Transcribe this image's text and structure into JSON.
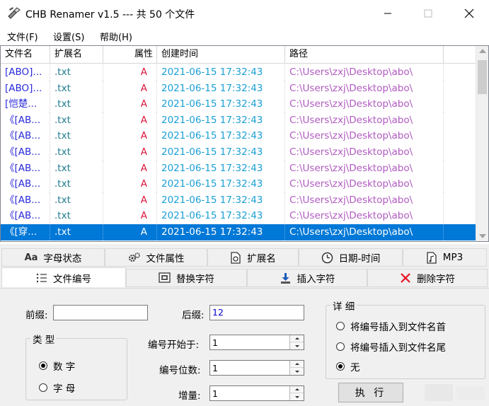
{
  "window": {
    "title": "CHB Renamer v1.5 --- 共 50 个文件"
  },
  "menu": [
    "文件(F)",
    "设置(S)",
    "帮助(H)"
  ],
  "list": {
    "columns": [
      "文件名",
      "扩展名",
      "属性",
      "创建时间",
      "路径"
    ],
    "rows": [
      {
        "name": "[ABO]...",
        "ext": ".txt",
        "attr": "A",
        "created": "2021-06-15 17:32:43",
        "path": "C:\\Users\\zxj\\Desktop\\abo\\"
      },
      {
        "name": "[ABO]...",
        "ext": ".txt",
        "attr": "A",
        "created": "2021-06-15 17:32:43",
        "path": "C:\\Users\\zxj\\Desktop\\abo\\"
      },
      {
        "name": "[恺楚...",
        "ext": ".txt",
        "attr": "A",
        "created": "2021-06-15 17:32:43",
        "path": "C:\\Users\\zxj\\Desktop\\abo\\"
      },
      {
        "name": "《[AB...",
        "ext": ".txt",
        "attr": "A",
        "created": "2021-06-15 17:32:43",
        "path": "C:\\Users\\zxj\\Desktop\\abo\\"
      },
      {
        "name": "《[AB...",
        "ext": ".txt",
        "attr": "A",
        "created": "2021-06-15 17:32:43",
        "path": "C:\\Users\\zxj\\Desktop\\abo\\"
      },
      {
        "name": "《[AB...",
        "ext": ".txt",
        "attr": "A",
        "created": "2021-06-15 17:32:43",
        "path": "C:\\Users\\zxj\\Desktop\\abo\\"
      },
      {
        "name": "《[AB...",
        "ext": ".txt",
        "attr": "A",
        "created": "2021-06-15 17:32:43",
        "path": "C:\\Users\\zxj\\Desktop\\abo\\"
      },
      {
        "name": "《[AB...",
        "ext": ".txt",
        "attr": "A",
        "created": "2021-06-15 17:32:43",
        "path": "C:\\Users\\zxj\\Desktop\\abo\\"
      },
      {
        "name": "《[AB...",
        "ext": ".txt",
        "attr": "A",
        "created": "2021-06-15 17:32:43",
        "path": "C:\\Users\\zxj\\Desktop\\abo\\"
      },
      {
        "name": "《[AB...",
        "ext": ".txt",
        "attr": "A",
        "created": "2021-06-15 17:32:43",
        "path": "C:\\Users\\zxj\\Desktop\\abo\\"
      },
      {
        "name": "《[穿...",
        "ext": ".txt",
        "attr": "A",
        "created": "2021-06-15 17:32:43",
        "path": "C:\\Users\\zxj\\Desktop\\abo\\",
        "selected": true
      }
    ]
  },
  "tabs": {
    "row1": [
      {
        "label": "字母状态",
        "icon": "Aa"
      },
      {
        "label": "文件属性",
        "icon": "gear-icon"
      },
      {
        "label": "扩展名",
        "icon": "document-icon"
      },
      {
        "label": "日期-时间",
        "icon": "clock-icon"
      },
      {
        "label": "MP3",
        "icon": "music-file-icon"
      }
    ],
    "row2": [
      {
        "label": "文件编号",
        "icon": "numbered-list-icon",
        "active": true
      },
      {
        "label": "替换字符",
        "icon": "replace-icon"
      },
      {
        "label": "插入字符",
        "icon": "insert-arrow-icon"
      },
      {
        "label": "删除字符",
        "icon": "delete-x-icon"
      }
    ]
  },
  "form": {
    "prefix_label": "前缀:",
    "prefix_value": "",
    "suffix_label": "后缀:",
    "suffix_value": "12",
    "start_label": "编号开始于:",
    "start_value": "1",
    "digits_label": "编号位数:",
    "digits_value": "1",
    "increment_label": "增量:",
    "increment_value": "1",
    "type_group": "类 型",
    "type_options": [
      "数 字",
      "字 母"
    ],
    "type_selected": 0,
    "detail_group": "详 细",
    "detail_options": [
      "将编号插入到文件名首",
      "将编号插入到文件名尾",
      "无"
    ],
    "detail_selected": 2,
    "execute_label": "执 行"
  },
  "colors": {
    "name": "#2a2ad8",
    "ext": "#1c7b8c",
    "attr": "#e0143c",
    "created": "#1a9fd6",
    "path": "#b05ac0",
    "selection": "#0078d7"
  }
}
